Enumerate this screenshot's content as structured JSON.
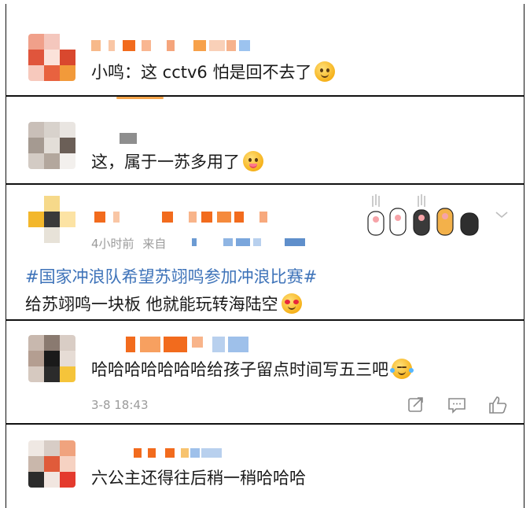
{
  "comments": [
    {
      "text": "小鸣：这 cctv6 怕是回不去了",
      "emoji": "drool-face"
    },
    {
      "text": "这，属于一苏多用了",
      "emoji": "tongue-face"
    },
    {
      "time": "4小时前",
      "source": "来自",
      "hashtag": "#国家冲浪队希望苏翊鸣参加冲浪比赛#",
      "text": "给苏翊鸣一块板 他就能玩转海陆空",
      "emoji": "heart-eyes-face"
    },
    {
      "text": "哈哈哈哈哈哈哈给孩子留点时间写五三吧",
      "emoji": "tears-of-joy-face",
      "time": "3-8 18:43"
    },
    {
      "text": "六公主还得往后稍一稍哈哈哈"
    }
  ],
  "colors": {
    "hashtag": "#3e73b9",
    "meta": "#9b9b9b",
    "accent_orange": "#f26b1d"
  },
  "icons": {
    "repost": "repost-icon",
    "comment": "comment-icon",
    "like": "like-icon",
    "chevron": "chevron-down-icon"
  }
}
